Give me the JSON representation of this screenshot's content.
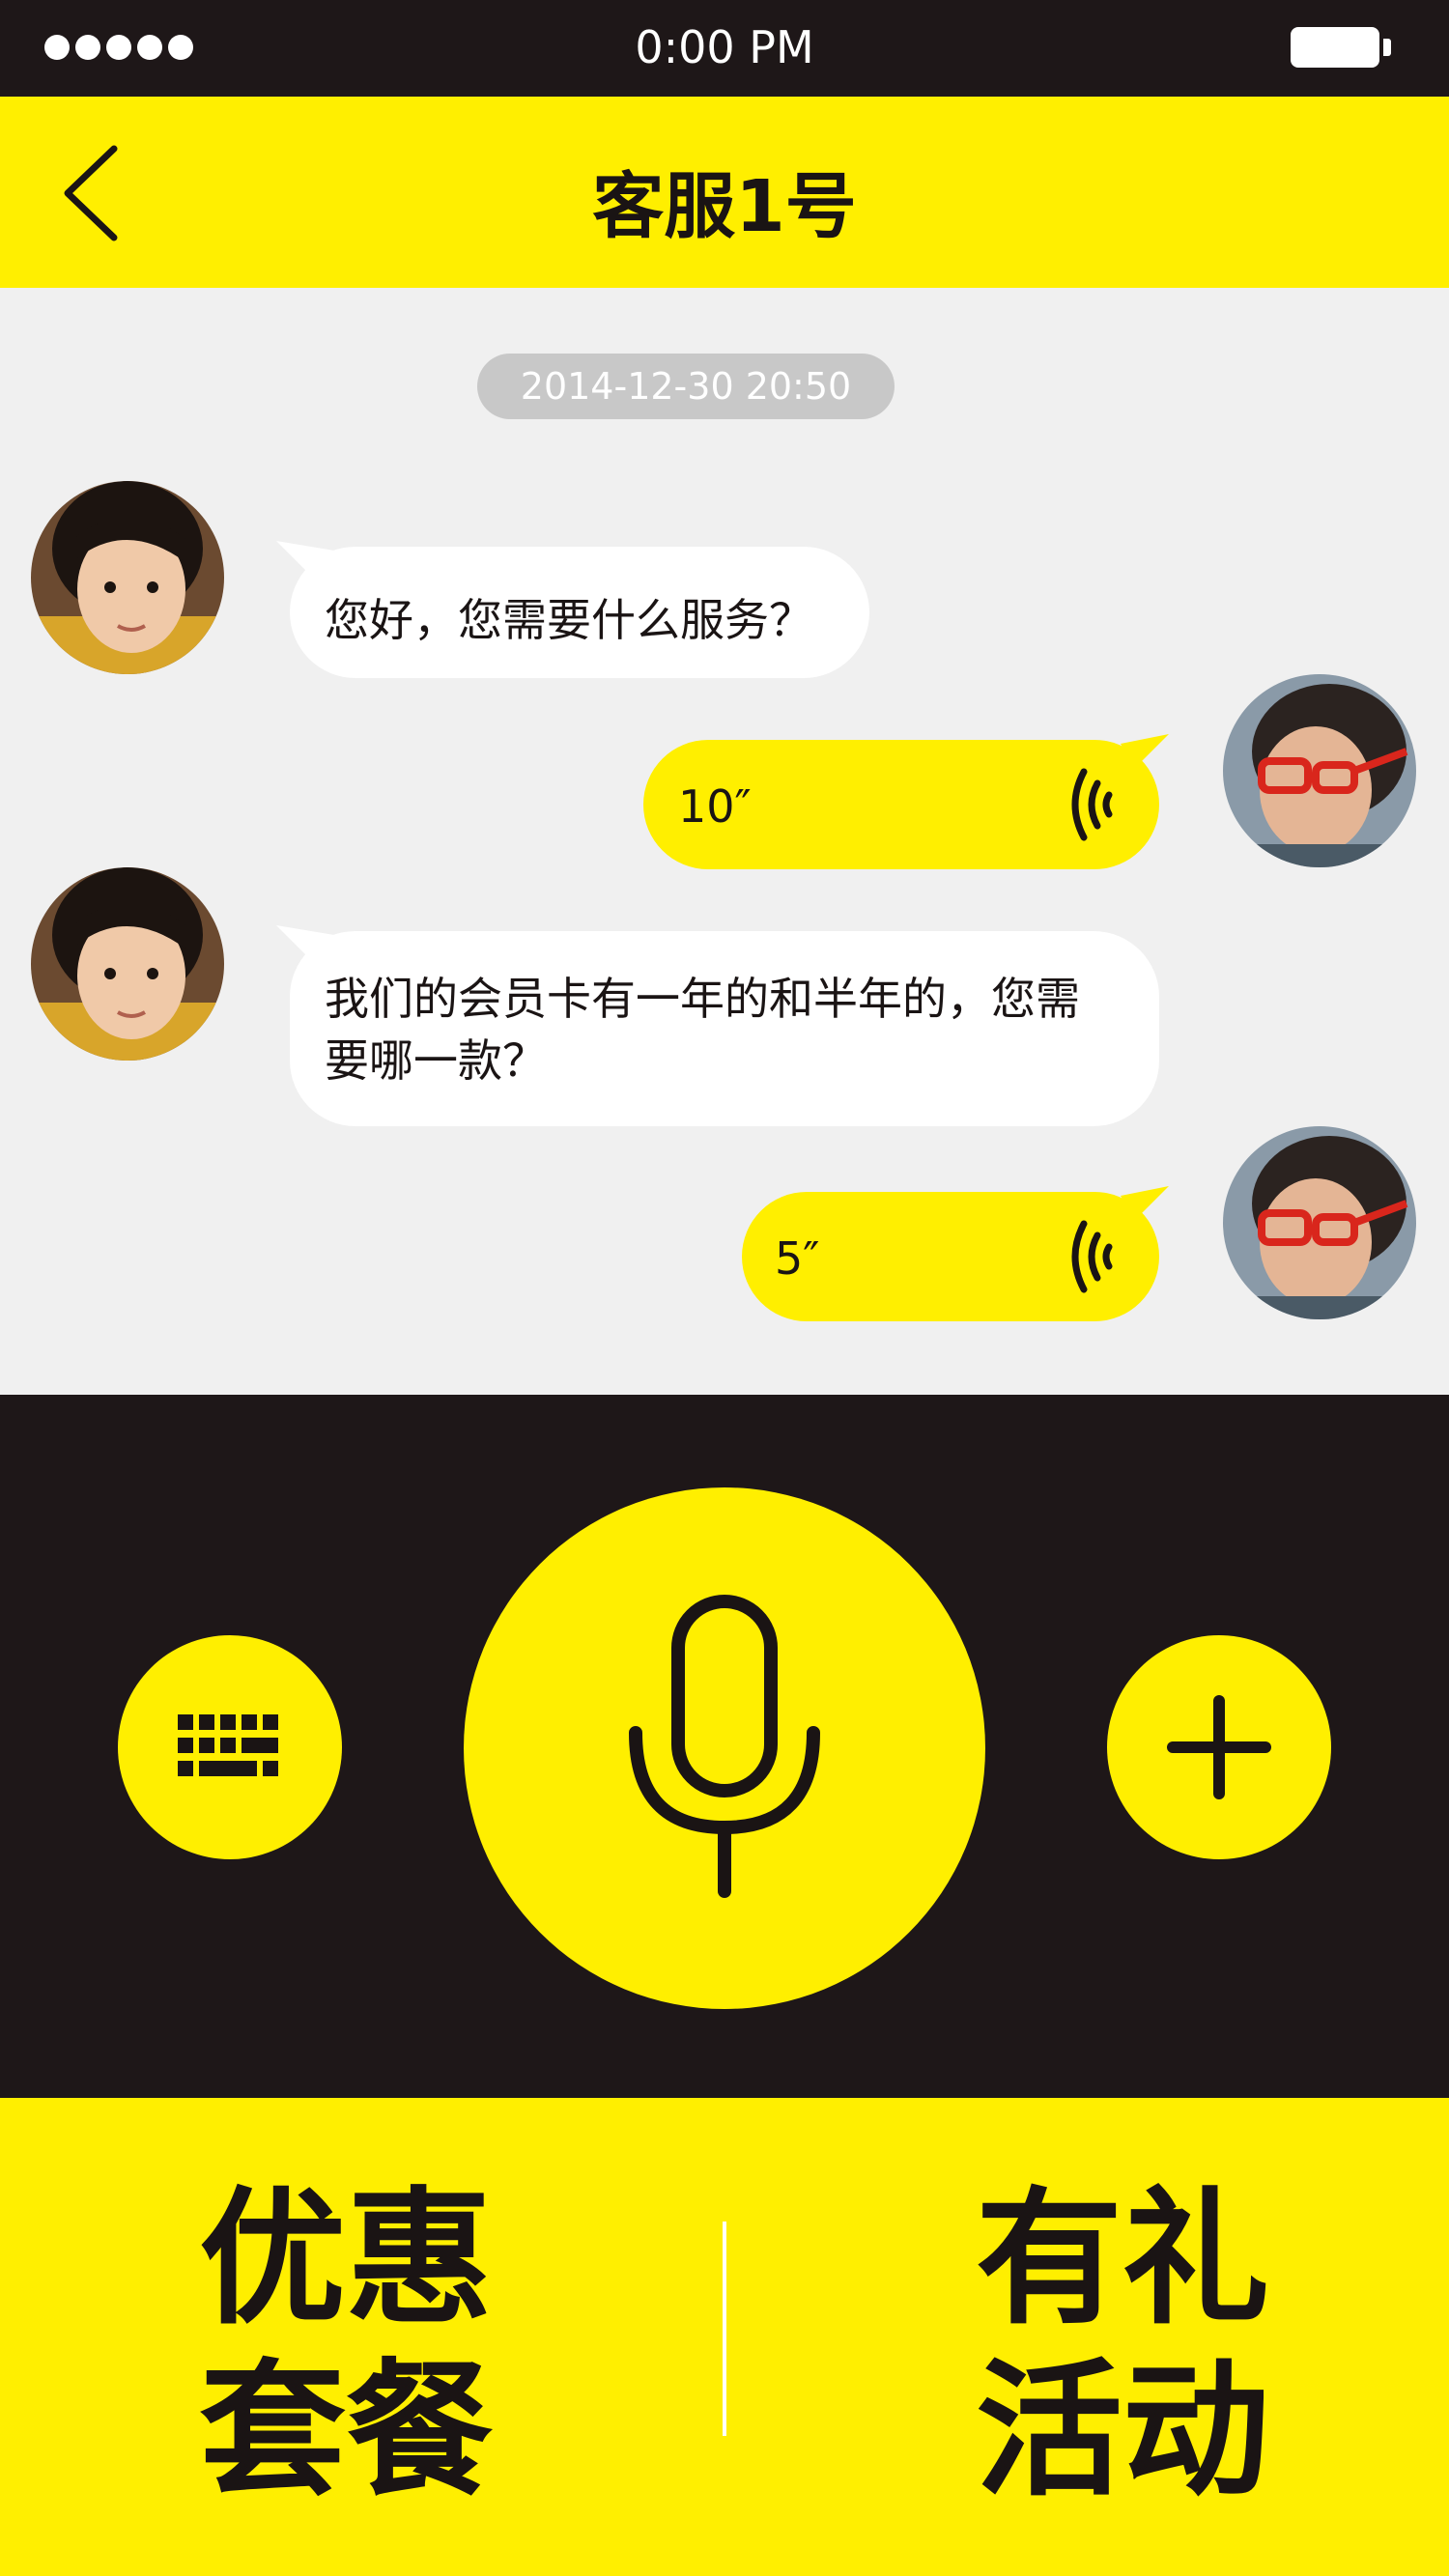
{
  "status_bar": {
    "time": "0:00 PM",
    "signal_icon": "signal-dots-icon",
    "battery_icon": "battery-icon"
  },
  "nav": {
    "title": "客服1号",
    "back_icon": "chevron-left-icon"
  },
  "chat": {
    "timestamp": "2014-12-30  20:50",
    "messages": [
      {
        "side": "left",
        "type": "text",
        "text": "您好，您需要什么服务？"
      },
      {
        "side": "right",
        "type": "voice",
        "duration": "10″"
      },
      {
        "side": "left",
        "type": "text",
        "text": "我们的会员卡有一年的和半年的，您需要哪一款？"
      },
      {
        "side": "right",
        "type": "voice",
        "duration": "5″"
      }
    ]
  },
  "controls": {
    "keyboard_icon": "keyboard-icon",
    "mic_icon": "microphone-icon",
    "plus_icon": "plus-icon"
  },
  "bottom_menu": {
    "left": {
      "line1": "优惠",
      "line2": "套餐"
    },
    "right": {
      "line1": "有礼",
      "line2": "活动"
    }
  },
  "colors": {
    "accent_yellow": "#ffef00",
    "dark": "#1e1718",
    "chat_background": "#f0f0f0"
  }
}
